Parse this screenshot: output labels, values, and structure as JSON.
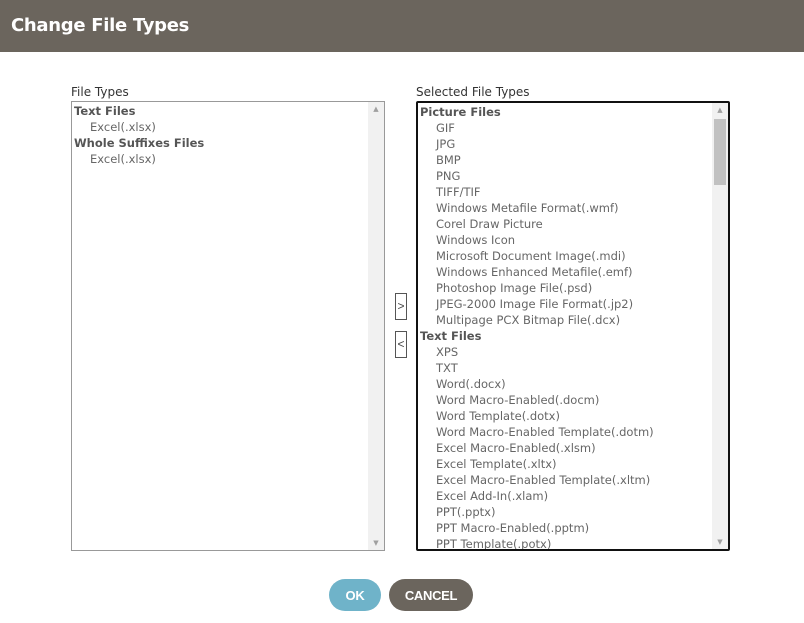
{
  "dialog": {
    "title": "Change File Types"
  },
  "left": {
    "label": "File Types",
    "items": [
      {
        "type": "group",
        "label": "Text Files"
      },
      {
        "type": "item",
        "label": "Excel(.xlsx)"
      },
      {
        "type": "group",
        "label": "Whole Suffixes Files"
      },
      {
        "type": "item",
        "label": "Excel(.xlsx)"
      }
    ]
  },
  "right": {
    "label": "Selected File Types",
    "items": [
      {
        "type": "group",
        "label": "Picture Files"
      },
      {
        "type": "item",
        "label": "GIF"
      },
      {
        "type": "item",
        "label": "JPG"
      },
      {
        "type": "item",
        "label": "BMP"
      },
      {
        "type": "item",
        "label": "PNG"
      },
      {
        "type": "item",
        "label": "TIFF/TIF"
      },
      {
        "type": "item",
        "label": "Windows Metafile Format(.wmf)"
      },
      {
        "type": "item",
        "label": "Corel Draw Picture"
      },
      {
        "type": "item",
        "label": "Windows Icon"
      },
      {
        "type": "item",
        "label": "Microsoft Document Image(.mdi)"
      },
      {
        "type": "item",
        "label": "Windows Enhanced Metafile(.emf)"
      },
      {
        "type": "item",
        "label": "Photoshop Image File(.psd)"
      },
      {
        "type": "item",
        "label": "JPEG-2000 Image File Format(.jp2)"
      },
      {
        "type": "item",
        "label": "Multipage PCX Bitmap File(.dcx)"
      },
      {
        "type": "group",
        "label": "Text Files"
      },
      {
        "type": "item",
        "label": "XPS"
      },
      {
        "type": "item",
        "label": "TXT"
      },
      {
        "type": "item",
        "label": "Word(.docx)"
      },
      {
        "type": "item",
        "label": "Word Macro-Enabled(.docm)"
      },
      {
        "type": "item",
        "label": "Word Template(.dotx)"
      },
      {
        "type": "item",
        "label": "Word Macro-Enabled Template(.dotm)"
      },
      {
        "type": "item",
        "label": "Excel Macro-Enabled(.xlsm)"
      },
      {
        "type": "item",
        "label": "Excel Template(.xltx)"
      },
      {
        "type": "item",
        "label": "Excel Macro-Enabled Template(.xltm)"
      },
      {
        "type": "item",
        "label": "Excel Add-In(.xlam)"
      },
      {
        "type": "item",
        "label": "PPT(.pptx)"
      },
      {
        "type": "item",
        "label": "PPT Macro-Enabled(.pptm)"
      },
      {
        "type": "item",
        "label": "PPT Template(.potx)"
      }
    ]
  },
  "move": {
    "add": ">",
    "remove": "<"
  },
  "buttons": {
    "ok": "OK",
    "cancel": "CANCEL"
  },
  "colors": {
    "header": "#6b655d",
    "ok": "#6fb3c9",
    "cancel": "#6b655d"
  }
}
